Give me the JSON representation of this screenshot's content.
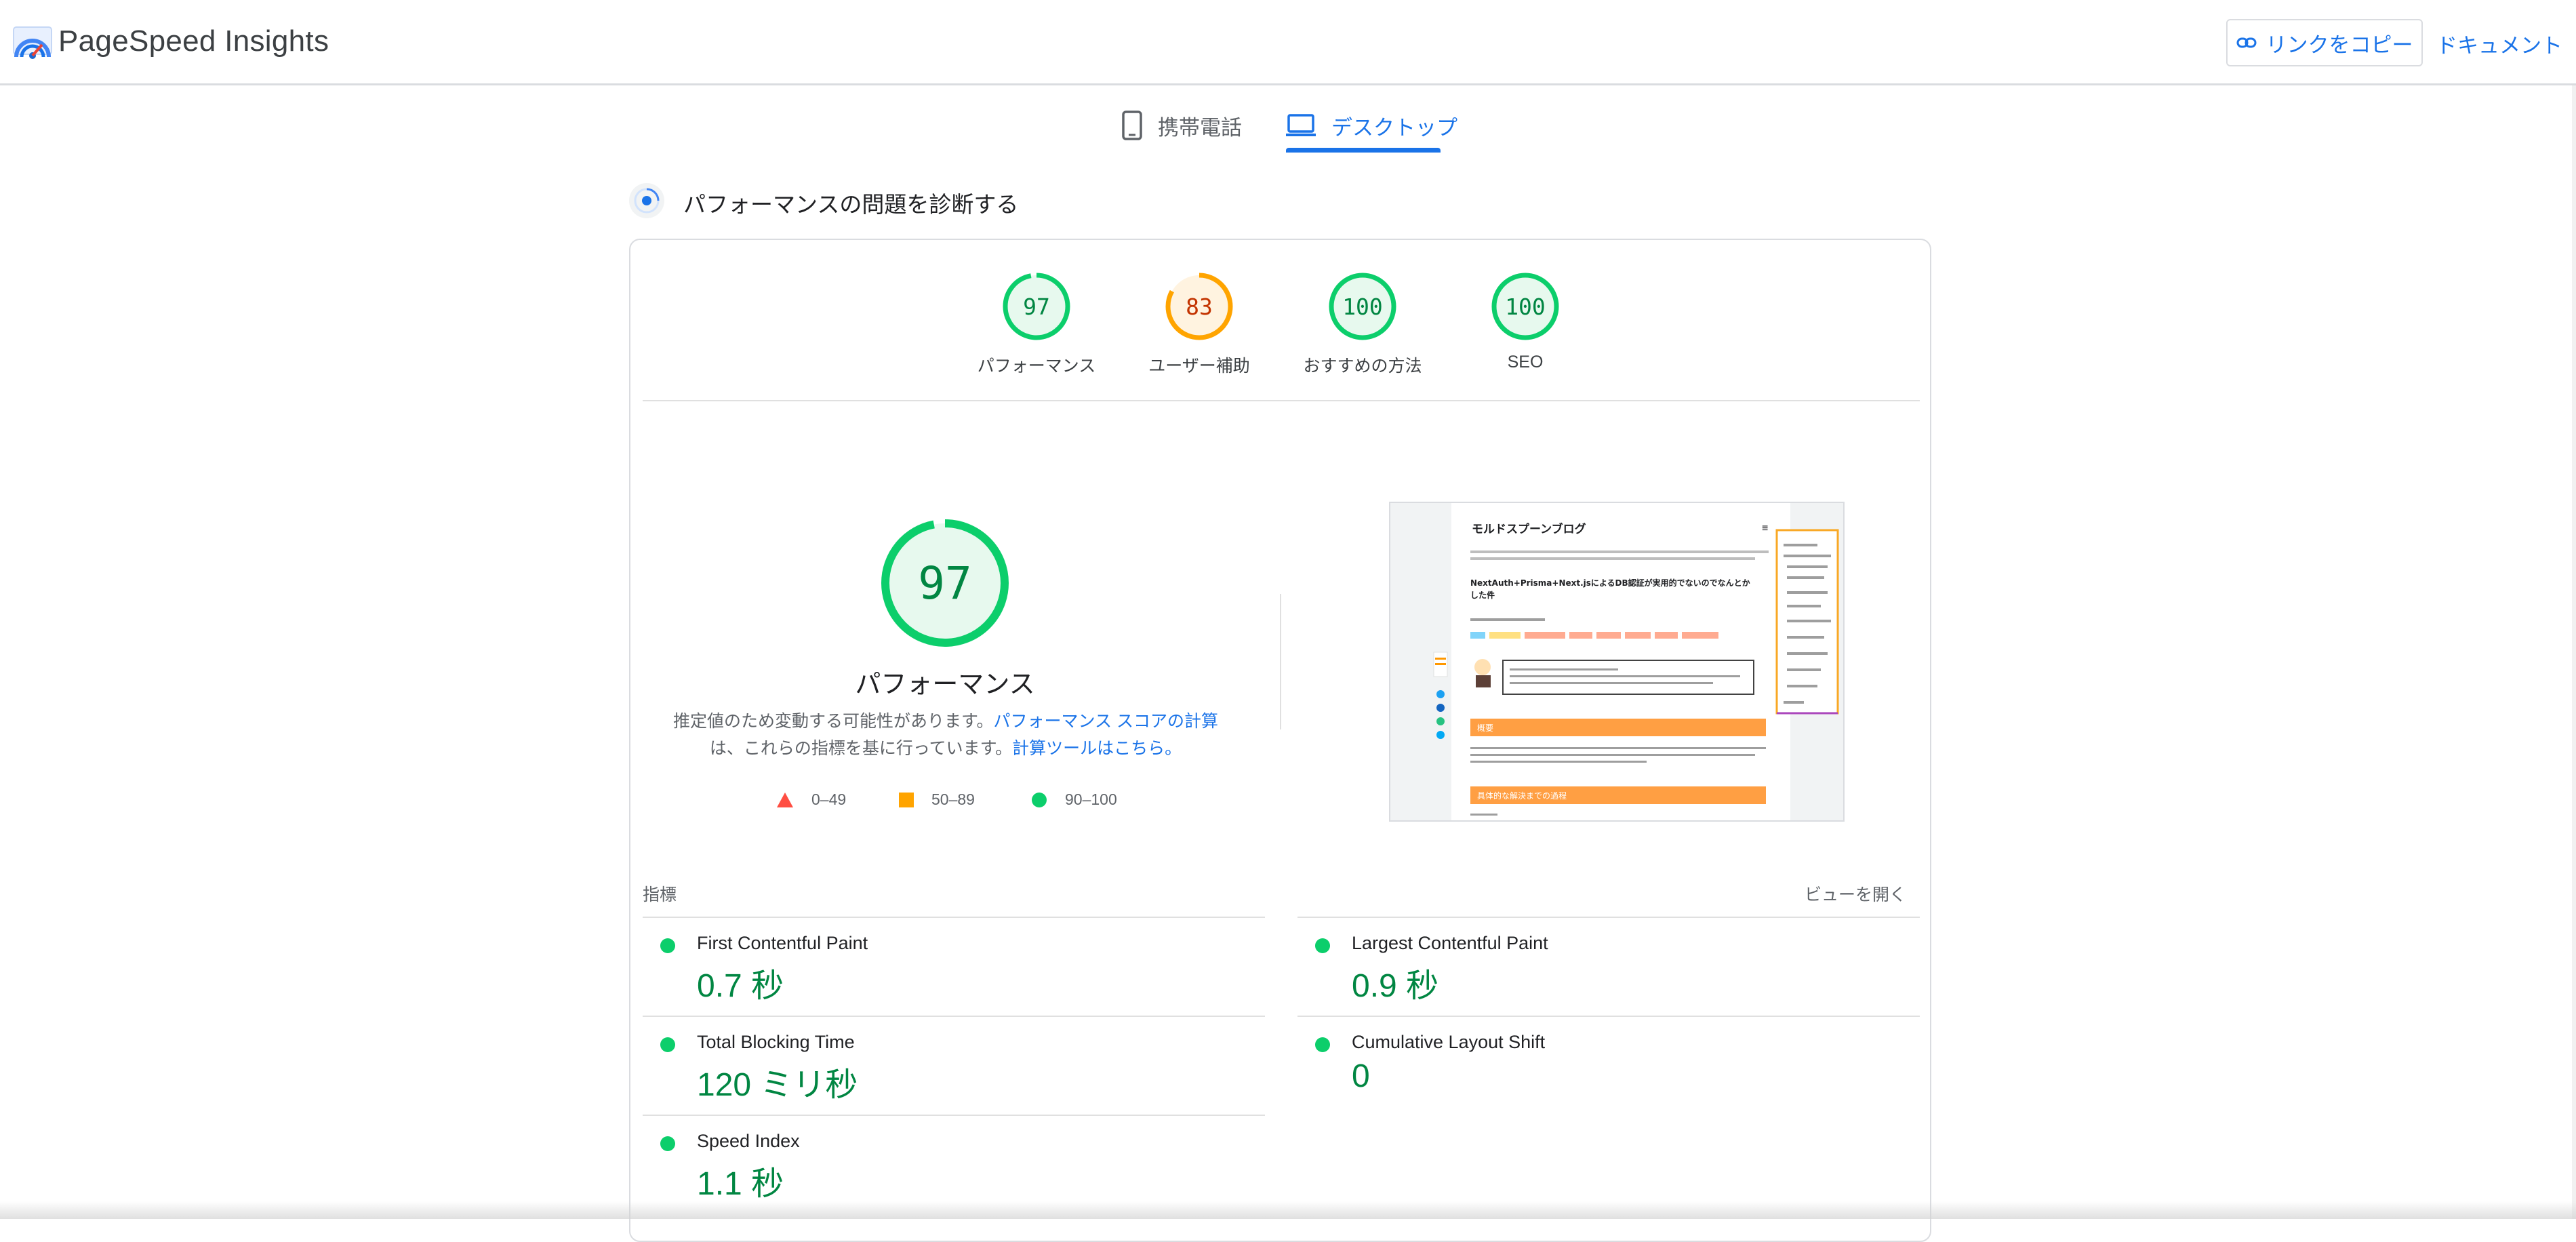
{
  "app": {
    "title": "PageSpeed Insights",
    "copy_link_label": "リンクをコピー",
    "docs_label": "ドキュメント"
  },
  "device_tabs": [
    {
      "label": "携帯電話",
      "icon": "phone-icon",
      "selected": false
    },
    {
      "label": "デスクトップ",
      "icon": "laptop-icon",
      "selected": true
    }
  ],
  "section": {
    "title": "パフォーマンスの問題を診断する",
    "icon": "diagnose-icon"
  },
  "category_scores": [
    {
      "score": "97",
      "label": "パフォーマンス",
      "color": "#0cce6b",
      "fraction": 0.97
    },
    {
      "score": "83",
      "label": "ユーザー補助",
      "color": "#ffa400",
      "fraction": 0.83
    },
    {
      "score": "100",
      "label": "おすすめの方法",
      "color": "#0cce6b",
      "fraction": 1.0
    },
    {
      "score": "100",
      "label": "SEO",
      "color": "#0cce6b",
      "fraction": 1.0
    }
  ],
  "performance": {
    "score": "97",
    "fraction": 0.97,
    "label": "パフォーマンス",
    "note_line1_prefix": "推定値のため変動する可能性があります。",
    "note_line1_link": "パフォーマンス スコアの計算",
    "note_line2_prefix": "は、これらの指標を基に行っています。",
    "note_line2_link": "計算ツールはこちら。"
  },
  "legend": [
    {
      "range": "0–49",
      "shape": "triangle",
      "color": "#ff4e42"
    },
    {
      "range": "50–89",
      "shape": "square",
      "color": "#ffa400"
    },
    {
      "range": "90–100",
      "shape": "circle",
      "color": "#0cce6b"
    }
  ],
  "screenshot": {
    "blog_title": "モルドスプーンブログ",
    "post_title_line1": "NextAuth+Prisma+Next.jsによるDB認証が実用的でないのでなんとか",
    "post_title_line2": "した件",
    "section1": "概要",
    "section2": "具体的な解決までの過程"
  },
  "metrics": {
    "heading": "指標",
    "expand_label": "ビューを開く",
    "items": [
      {
        "name": "First Contentful Paint",
        "value": "0.7 秒"
      },
      {
        "name": "Largest Contentful Paint",
        "value": "0.9 秒"
      },
      {
        "name": "Total Blocking Time",
        "value": "120 ミリ秒"
      },
      {
        "name": "Cumulative Layout Shift",
        "value": "0"
      },
      {
        "name": "Speed Index",
        "value": "1.1 秒"
      }
    ]
  }
}
